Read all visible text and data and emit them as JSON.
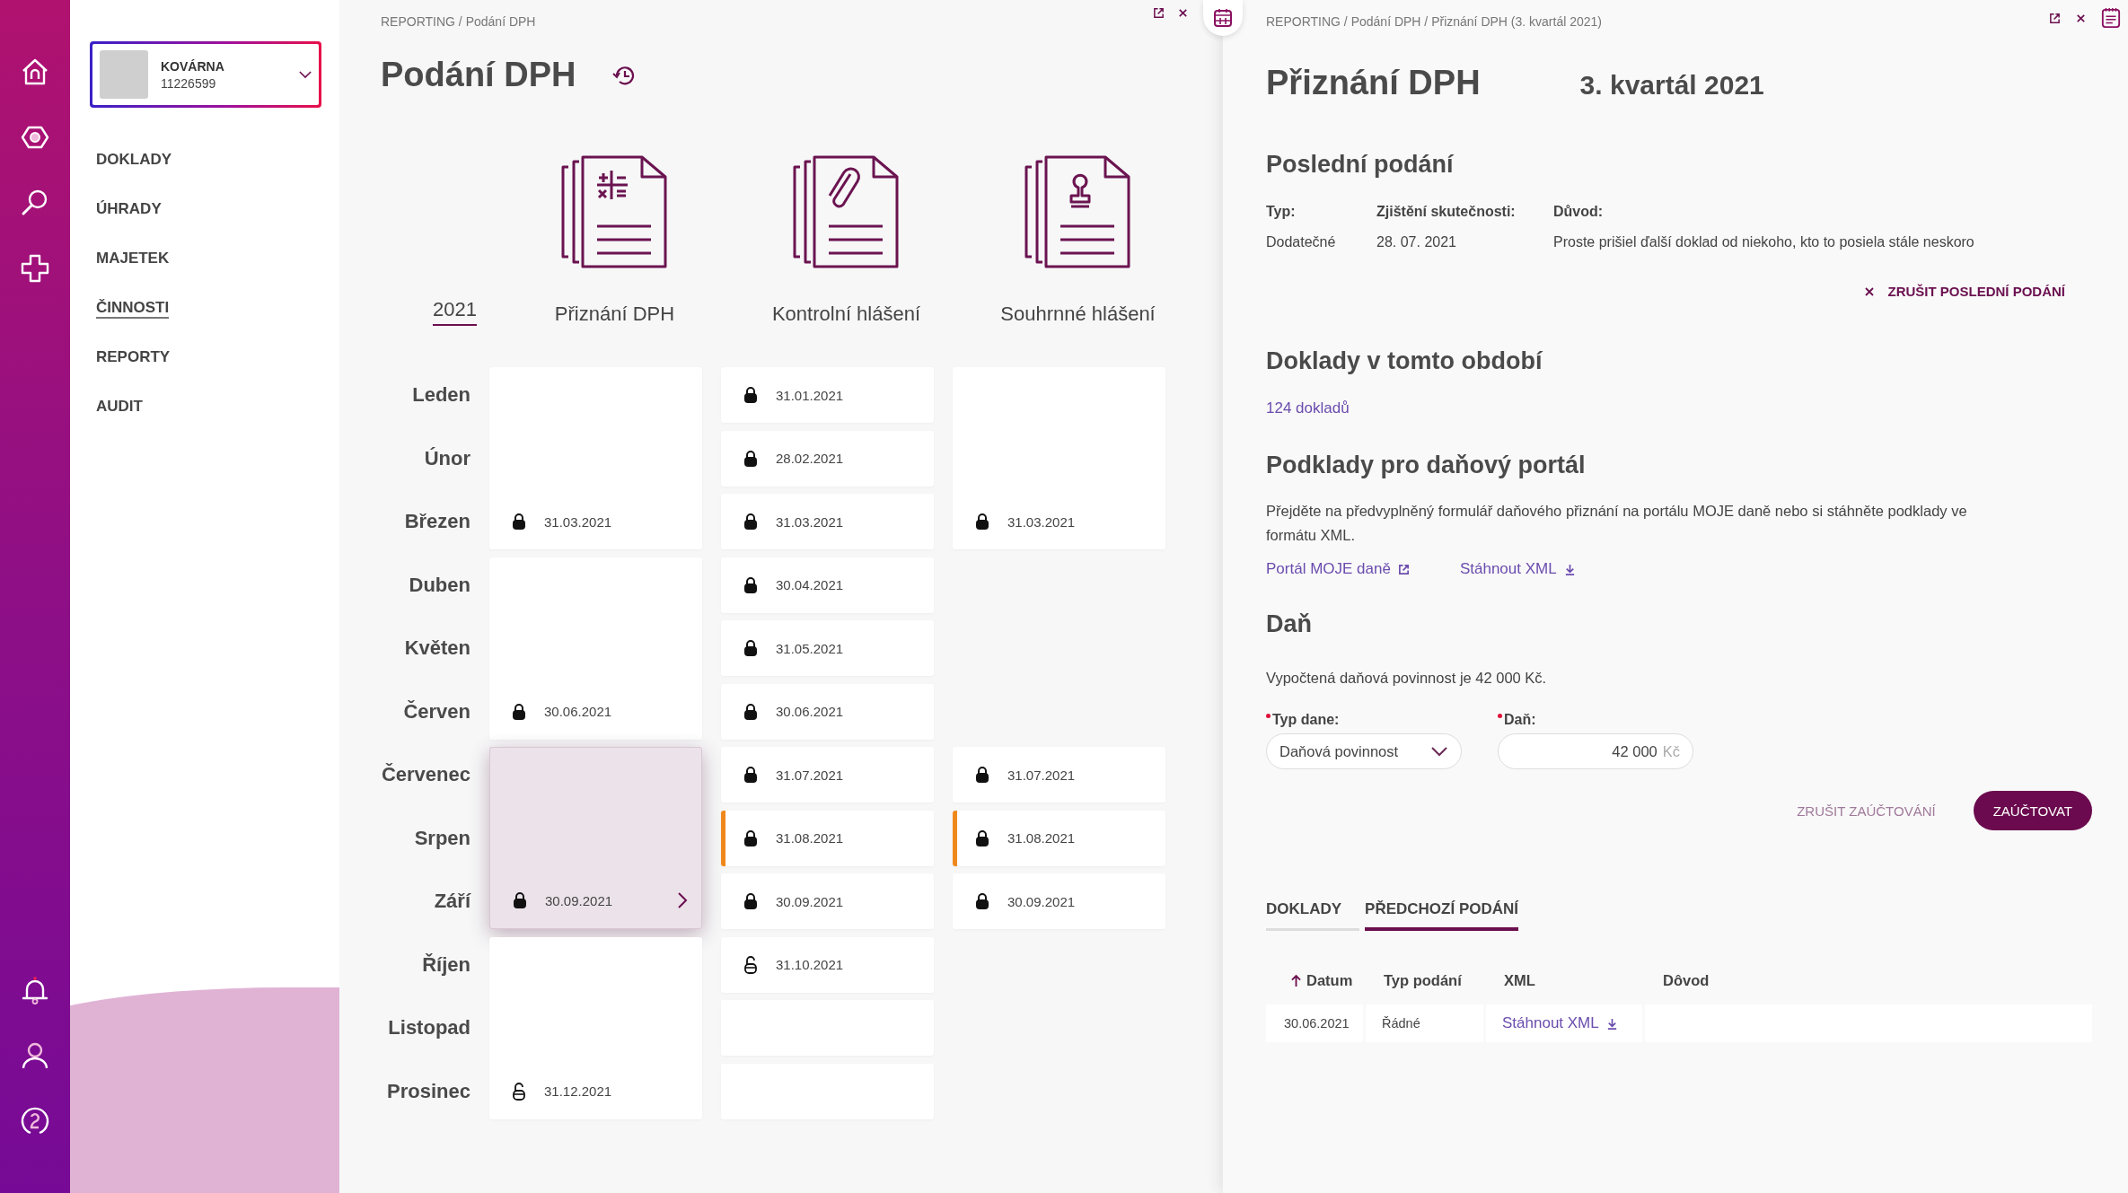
{
  "company": {
    "name": "KOVÁRNA",
    "id": "11226599"
  },
  "nav": [
    {
      "label": "DOKLADY",
      "selected": false
    },
    {
      "label": "ÚHRADY",
      "selected": false
    },
    {
      "label": "MAJETEK",
      "selected": false
    },
    {
      "label": "ČINNOSTI",
      "selected": true
    },
    {
      "label": "REPORTY",
      "selected": false
    },
    {
      "label": "AUDIT",
      "selected": false
    }
  ],
  "reporting": {
    "breadcrumb": "REPORTING / Podání DPH",
    "title": "Podání DPH",
    "year": "2021",
    "months": [
      "Leden",
      "Únor",
      "Březen",
      "Duben",
      "Květen",
      "Červen",
      "Červenec",
      "Srpen",
      "Září",
      "Říjen",
      "Listopad",
      "Prosinec"
    ],
    "columns": [
      {
        "title": "Přiznání DPH",
        "kind": "calculator",
        "cells": [
          {
            "kind": "quarter",
            "date": "31.03.2021",
            "locked": true,
            "flagged": false,
            "selected": false
          },
          {
            "kind": "quarter",
            "date": "30.06.2021",
            "locked": true,
            "flagged": false,
            "selected": false
          },
          {
            "kind": "quarter",
            "date": "30.09.2021",
            "locked": true,
            "flagged": false,
            "selected": true
          },
          {
            "kind": "quarter",
            "date": "31.12.2021",
            "locked": false,
            "flagged": false,
            "selected": false
          }
        ]
      },
      {
        "title": "Kontrolní hlášení",
        "kind": "paperclip",
        "cells": [
          {
            "kind": "month",
            "date": "31.01.2021",
            "locked": true,
            "flagged": false
          },
          {
            "kind": "month",
            "date": "28.02.2021",
            "locked": true,
            "flagged": false
          },
          {
            "kind": "month",
            "date": "31.03.2021",
            "locked": true,
            "flagged": false
          },
          {
            "kind": "month",
            "date": "30.04.2021",
            "locked": true,
            "flagged": false
          },
          {
            "kind": "month",
            "date": "31.05.2021",
            "locked": true,
            "flagged": false
          },
          {
            "kind": "month",
            "date": "30.06.2021",
            "locked": true,
            "flagged": false
          },
          {
            "kind": "month",
            "date": "31.07.2021",
            "locked": true,
            "flagged": false
          },
          {
            "kind": "month",
            "date": "31.08.2021",
            "locked": true,
            "flagged": true
          },
          {
            "kind": "month",
            "date": "30.09.2021",
            "locked": true,
            "flagged": false
          },
          {
            "kind": "month",
            "date": "31.10.2021",
            "locked": false,
            "flagged": false
          },
          {
            "kind": "month"
          },
          {
            "kind": "month"
          }
        ]
      },
      {
        "title": "Souhrnné hlášení",
        "kind": "stamp",
        "cells": [
          {
            "kind": "quarter",
            "date": "31.03.2021",
            "locked": true,
            "flagged": false
          },
          {
            "kind": "gap"
          },
          {
            "kind": "month",
            "date": "31.07.2021",
            "locked": true,
            "flagged": false
          },
          {
            "kind": "month",
            "date": "31.08.2021",
            "locked": true,
            "flagged": true
          },
          {
            "kind": "month",
            "date": "30.09.2021",
            "locked": true,
            "flagged": false
          },
          {
            "kind": "gap"
          }
        ]
      }
    ]
  },
  "detail": {
    "breadcrumb": "REPORTING / Podání DPH / Přiznání DPH (3. kvartál 2021)",
    "title": "Přiznání DPH",
    "period": "3. kvartál 2021",
    "last_filing": {
      "heading": "Poslední podání",
      "fields": [
        {
          "label": "Typ:",
          "value": "Dodatečné"
        },
        {
          "label": "Zjištění skutečnosti:",
          "value": "28. 07. 2021"
        },
        {
          "label": "Důvod:",
          "value": "Proste prišiel ďalší doklad od niekoho, kto to posiela stále neskoro"
        }
      ],
      "cancel": "ZRUŠIT POSLEDNÍ PODÁNÍ"
    },
    "documents": {
      "heading": "Doklady v tomto období",
      "link": "124 dokladů"
    },
    "portal": {
      "heading": "Podklady pro daňový portál",
      "text": "Přejděte na předvyplněný formulář daňového přiznání na portálu MOJE daně nebo si stáhněte podklady ve formátu XML.",
      "links": [
        {
          "label": "Portál MOJE daně",
          "kind": "external"
        },
        {
          "label": "Stáhnout XML",
          "kind": "download"
        }
      ]
    },
    "tax": {
      "heading": "Daň",
      "text": "Vypočtená daňová povinnost je 42 000 Kč.",
      "type_field": {
        "label": "Typ dane:",
        "value": "Daňová povinnost",
        "required": true
      },
      "amount_field": {
        "label": "Daň:",
        "value": "42 000",
        "unit": "Kč",
        "required": true
      },
      "secondary_button": "ZRUŠIT ZAÚČTOVÁNÍ",
      "primary_button": "ZAÚČTOVAT"
    },
    "tabs": [
      {
        "label": "DOKLADY",
        "selected": false
      },
      {
        "label": "PŘEDCHOZÍ PODÁNÍ",
        "selected": true
      }
    ],
    "table": {
      "columns": [
        {
          "label": "Datum",
          "sorted": true
        },
        {
          "label": "Typ podání",
          "sorted": false
        },
        {
          "label": "XML",
          "sorted": false
        },
        {
          "label": "Dôvod",
          "sorted": false
        }
      ],
      "rows": [
        {
          "date": "30.06.2021",
          "type": "Řádné",
          "xml": "Stáhnout XML"
        }
      ]
    }
  }
}
